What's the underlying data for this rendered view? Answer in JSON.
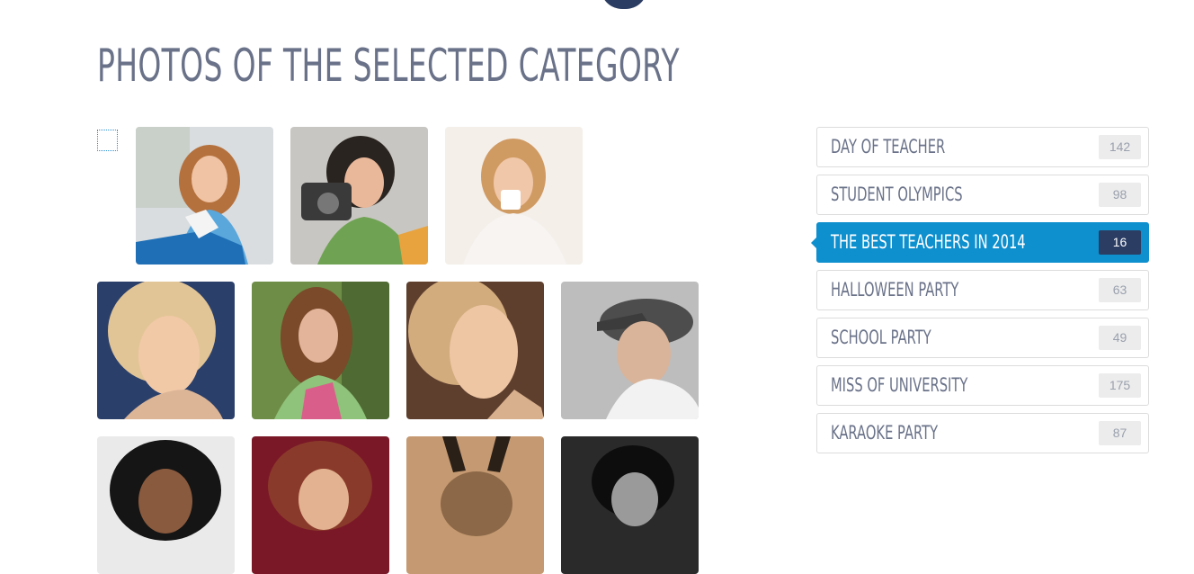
{
  "page": {
    "title": "PHOTOS OF THE SELECTED CATEGORY"
  },
  "colors": {
    "accent": "#0e8fce",
    "dark_navy": "#2b3d63",
    "title_text": "#6a7289",
    "badge_bg": "#ececec"
  },
  "categories": [
    {
      "label": "DAY OF TEACHER",
      "count": "142",
      "active": false
    },
    {
      "label": "STUDENT OLYMPICS",
      "count": "98",
      "active": false
    },
    {
      "label": "THE BEST TEACHERS IN 2014",
      "count": "16",
      "active": true
    },
    {
      "label": "HALLOWEEN PARTY",
      "count": "63",
      "active": false
    },
    {
      "label": "SCHOOL PARTY",
      "count": "49",
      "active": false
    },
    {
      "label": "MISS OF UNIVERSITY",
      "count": "175",
      "active": false
    },
    {
      "label": "KARAOKE PARTY",
      "count": "87",
      "active": false
    }
  ]
}
